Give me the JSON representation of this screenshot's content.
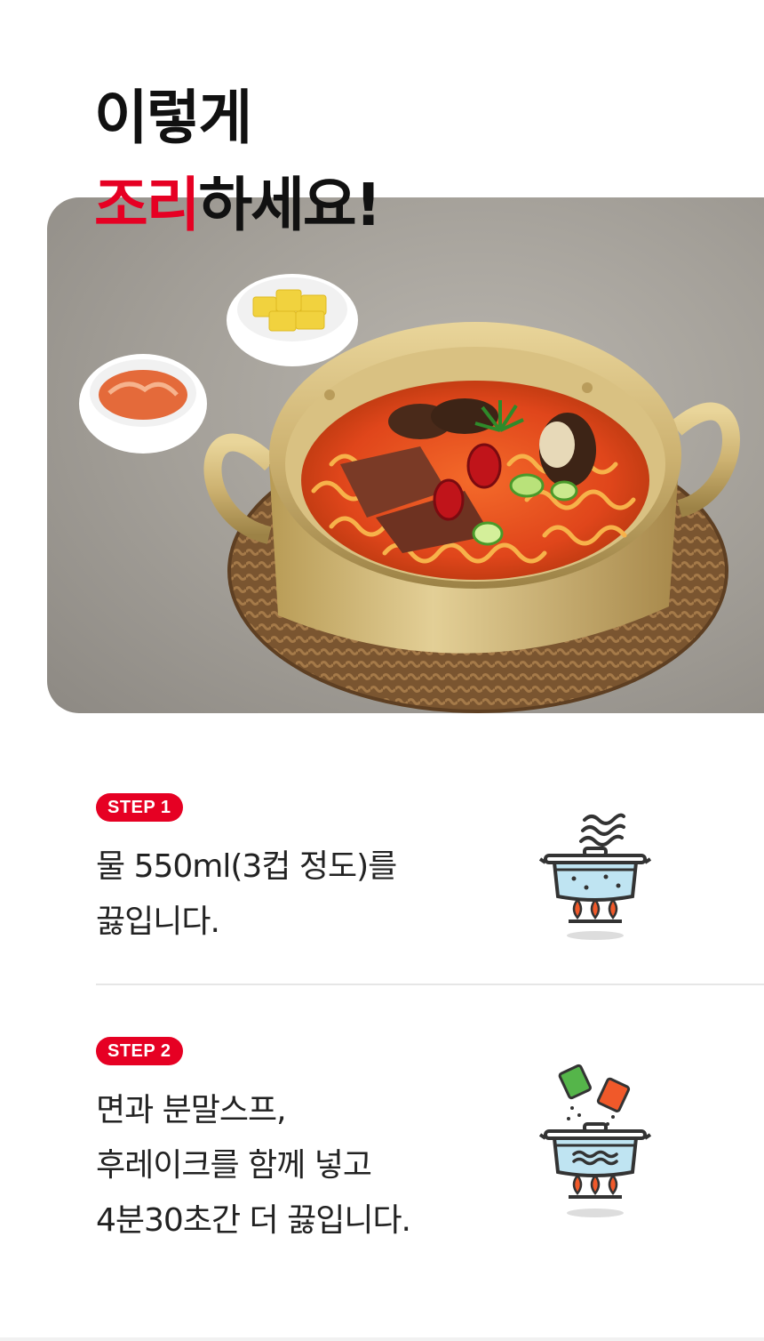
{
  "header": {
    "title_line1": "이렇게",
    "title_line2_red": "조리",
    "title_line2_black": "하세요!"
  },
  "hero_image": {
    "icon": "ramen-pot-photo"
  },
  "steps": [
    {
      "badge": "STEP 1",
      "lines": [
        "물 550ml(3컵 정도)를",
        "끓입니다."
      ],
      "icon": "boiling-pot-icon"
    },
    {
      "badge": "STEP 2",
      "lines": [
        "면과 분말스프,",
        "후레이크를 함께 넣고",
        "4분30초간 더 끓입니다."
      ],
      "icon": "add-ingredients-pot-icon"
    }
  ],
  "colors": {
    "accent": "#e60023",
    "text": "#222222",
    "water": "#bfe4f2",
    "flame": "#f0592a"
  }
}
